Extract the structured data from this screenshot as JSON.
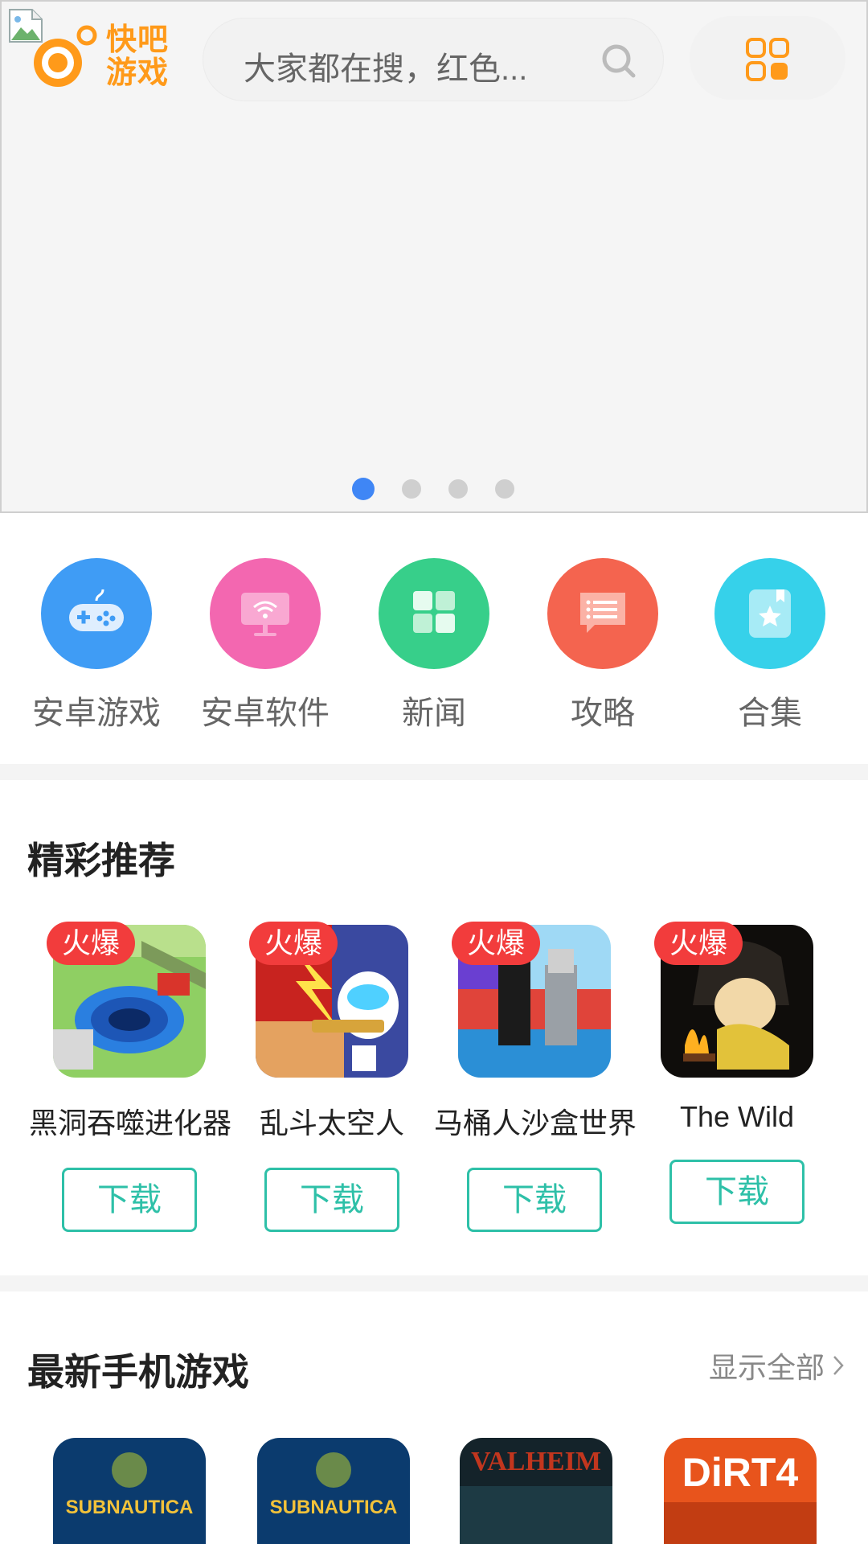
{
  "header": {
    "logo_text": "快吧游戏",
    "search_placeholder": "大家都在搜，红色..."
  },
  "banner": {
    "slide_count": 4,
    "active_slide": 1,
    "active_color": "#3f86f5"
  },
  "categories": [
    {
      "label": "安卓游戏",
      "icon": "gamepad-icon",
      "color": "#3f9cf5"
    },
    {
      "label": "安卓软件",
      "icon": "monitor-icon",
      "color": "#f367b0"
    },
    {
      "label": "新闻",
      "icon": "grid-icon",
      "color": "#37cf8a"
    },
    {
      "label": "攻略",
      "icon": "message-list-icon",
      "color": "#f4644f"
    },
    {
      "label": "合集",
      "icon": "star-bookmark-icon",
      "color": "#36d1ea"
    }
  ],
  "featured": {
    "title": "精彩推荐",
    "badge": "火爆",
    "download_label": "下载",
    "games": [
      {
        "name": "黑洞吞噬进化器"
      },
      {
        "name": "乱斗太空人"
      },
      {
        "name": "马桶人沙盒世界"
      },
      {
        "name": "The Wild"
      }
    ]
  },
  "latest": {
    "title": "最新手机游戏",
    "show_all": "显示全部",
    "games": [
      {
        "art_text": "SUBNAUTICA"
      },
      {
        "art_text": "SUBNAUTICA"
      },
      {
        "art_text": "VALHEIM"
      },
      {
        "art_text": "DiRT4"
      }
    ]
  },
  "colors": {
    "accent_orange": "#ff9a1a",
    "download_green": "#2ec0a8",
    "hot_red": "#f23c3c"
  }
}
